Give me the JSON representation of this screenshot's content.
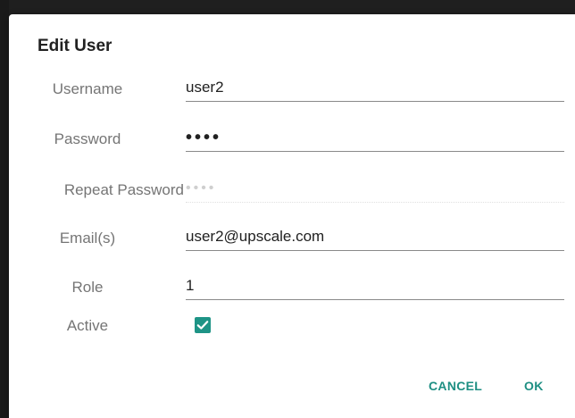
{
  "dialog": {
    "title": "Edit User"
  },
  "fields": {
    "username": {
      "label": "Username",
      "value": "user2"
    },
    "password": {
      "label": "Password",
      "value": "••••"
    },
    "repeat_password": {
      "label": "Repeat Password",
      "value": "••••"
    },
    "emails": {
      "label": "Email(s)",
      "value": "user2@upscale.com"
    },
    "role": {
      "label": "Role",
      "value": "1"
    },
    "active": {
      "label": "Active",
      "checked": true
    }
  },
  "actions": {
    "cancel_label": "CANCEL",
    "ok_label": "OK"
  },
  "colors": {
    "accent": "#1e9486",
    "button_text": "#1e8f83",
    "label_text": "#757575",
    "value_text": "#212121"
  },
  "icons": {
    "active_checkbox": "check-icon"
  }
}
